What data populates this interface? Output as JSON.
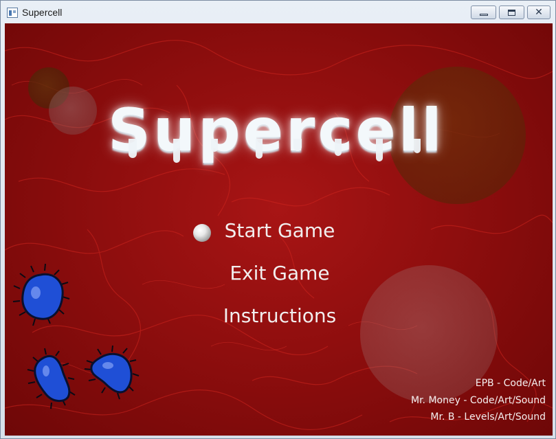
{
  "window": {
    "title": "Supercell",
    "close_glyph": "✕"
  },
  "game": {
    "logo_text": "Supercell",
    "menu": {
      "items": [
        "Start Game",
        "Exit Game",
        "Instructions"
      ],
      "selected_index": 0
    },
    "credits": [
      "EPB - Code/Art",
      "Mr. Money - Code/Art/Sound",
      "Mr. B - Levels/Art/Sound"
    ],
    "colors": {
      "background": "#9a1010",
      "cell_fill": "#1f4fd6",
      "text": "#f2eeee"
    }
  }
}
